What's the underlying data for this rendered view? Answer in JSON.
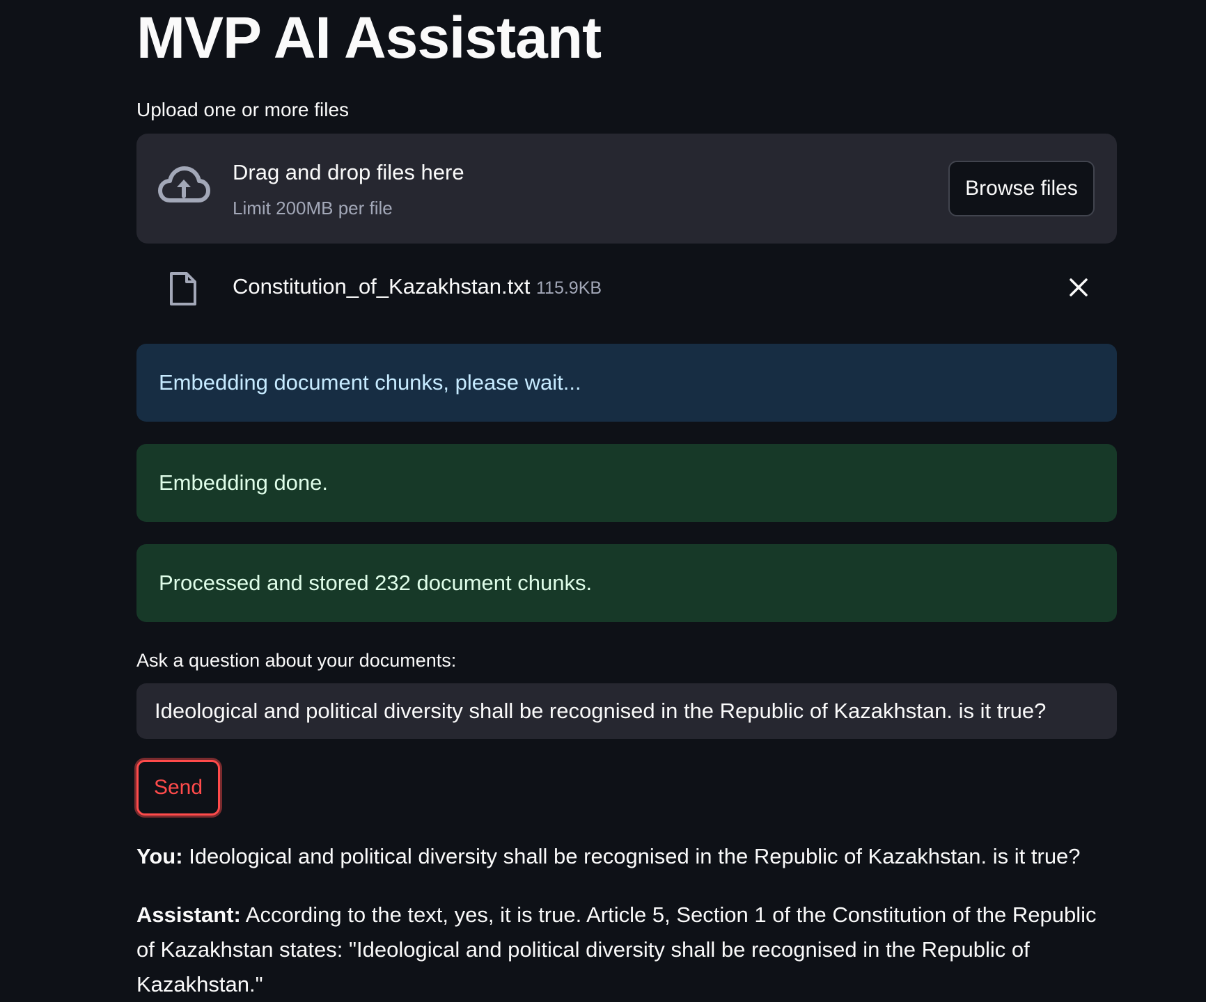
{
  "app": {
    "title": "MVP AI Assistant"
  },
  "uploader": {
    "label": "Upload one or more files",
    "drop_text": "Drag and drop files here",
    "limit_text": "Limit 200MB per file",
    "browse_label": "Browse files",
    "icon": "cloud-upload-icon"
  },
  "file": {
    "name": "Constitution_of_Kazakhstan.txt",
    "size": "115.9KB",
    "icon": "file-icon",
    "remove_icon": "close-icon"
  },
  "alerts": {
    "info": "Embedding document chunks, please wait...",
    "success_1": "Embedding done.",
    "success_2": "Processed and stored 232 document chunks."
  },
  "question": {
    "label": "Ask a question about your documents:",
    "value": "Ideological and political diversity shall be recognised in the Republic of Kazakhstan. is it true?"
  },
  "send_label": "Send",
  "chat": {
    "user_speaker": "You:",
    "user_message": "Ideological and political diversity shall be recognised in the Republic of Kazakhstan. is it true?",
    "assistant_speaker": "Assistant:",
    "assistant_message": "According to the text, yes, it is true. Article 5, Section 1 of the Constitution of the Republic of Kazakhstan states: \"Ideological and political diversity shall be recognised in the Republic of Kazakhstan.\""
  },
  "colors": {
    "background": "#0e1117",
    "panel": "#262730",
    "info_bg": "#172d43",
    "success_bg": "#173928",
    "accent": "#ff4b4b"
  }
}
